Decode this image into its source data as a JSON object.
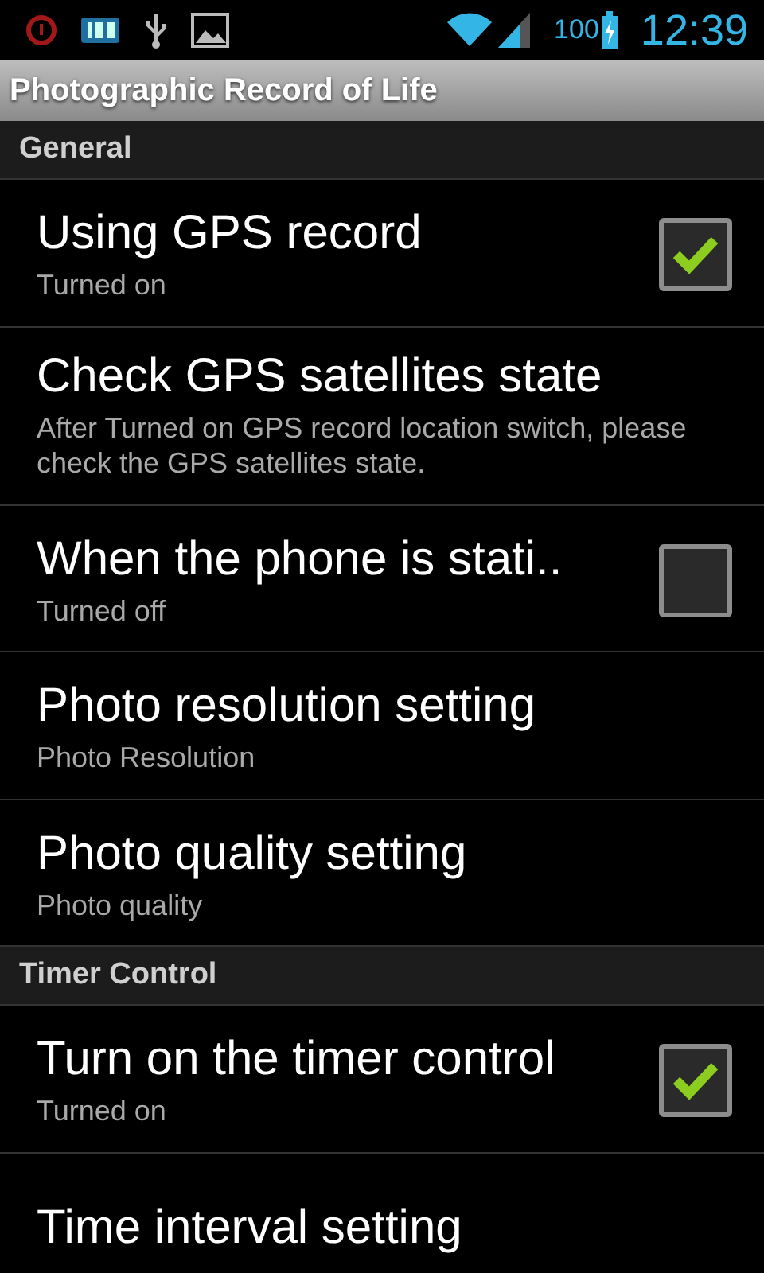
{
  "status_bar": {
    "battery_percent": "100",
    "time": "12:39"
  },
  "title": "Photographic Record of Life",
  "sections": [
    {
      "header": "General",
      "items": [
        {
          "kind": "checkbox",
          "title": "Using GPS record",
          "summary": "Turned on",
          "checked": true
        },
        {
          "kind": "plain",
          "title": "Check GPS satellites state",
          "summary": "After Turned on GPS record location switch, please check the GPS satellites state."
        },
        {
          "kind": "checkbox",
          "title": "When the phone is stati..",
          "summary": "Turned off",
          "checked": false
        },
        {
          "kind": "plain",
          "title": "Photo resolution setting",
          "summary": "Photo Resolution"
        },
        {
          "kind": "plain",
          "title": "Photo quality setting",
          "summary": "Photo quality"
        }
      ]
    },
    {
      "header": "Timer Control",
      "items": [
        {
          "kind": "checkbox",
          "title": "Turn on the timer control",
          "summary": "Turned on",
          "checked": true
        },
        {
          "kind": "plain",
          "title": "Time interval setting"
        }
      ]
    }
  ]
}
